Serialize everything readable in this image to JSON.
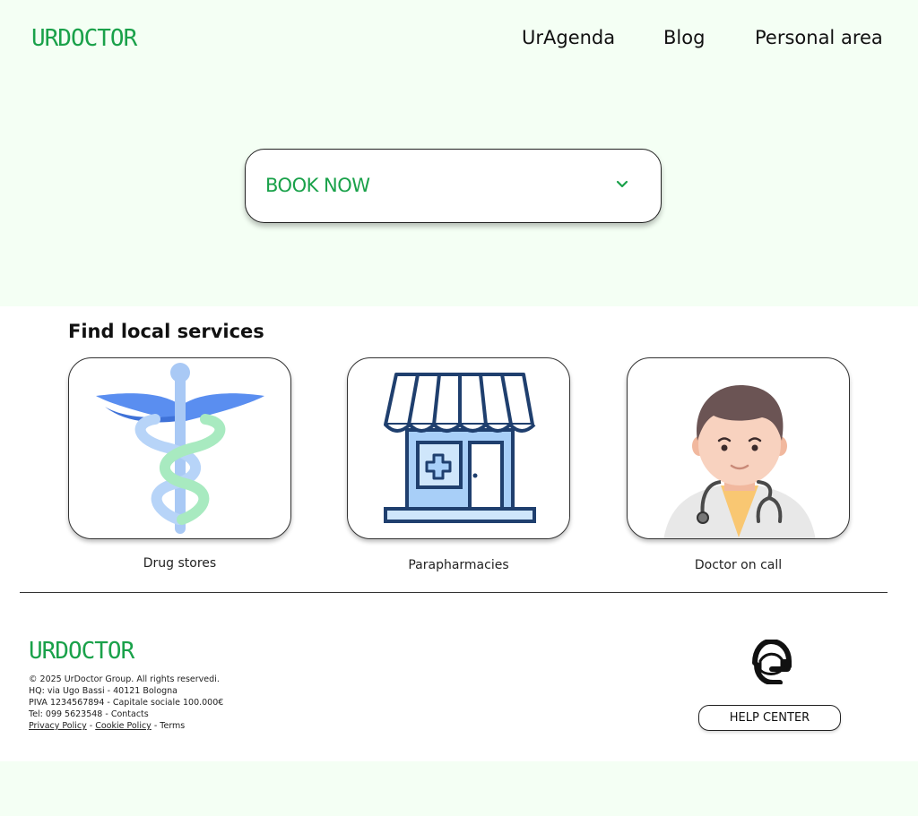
{
  "header": {
    "logo": "URDOCTOR",
    "nav": [
      "UrAgenda",
      "Blog",
      "Personal area"
    ]
  },
  "booking": {
    "label": "BOOK NOW"
  },
  "services": {
    "title": "Find local services",
    "items": [
      {
        "label": "Drug stores",
        "icon": "caduceus-icon"
      },
      {
        "label": "Parapharmacies",
        "icon": "pharmacy-store-icon"
      },
      {
        "label": "Doctor on call",
        "icon": "doctor-icon"
      }
    ]
  },
  "footer": {
    "logo": "URDOCTOR",
    "copyright": "© 2025  UrDoctor Group. All rights reservedi.",
    "hq": "HQ: via Ugo Bassi  - 40121 Bologna",
    "piva": "PIVA 1234567894 - Capitale sociale 100.000€",
    "tel": "Tel: 099 5623548 - Contacts",
    "links": [
      "Privacy Policy",
      "Cookie Policy",
      "Terms"
    ],
    "link_sep": " - ",
    "help_label": "HELP CENTER",
    "help_icon": "support-agent-icon"
  },
  "colors": {
    "brand_green": "#1aa14a",
    "hero_bg": "#f4fff4"
  }
}
